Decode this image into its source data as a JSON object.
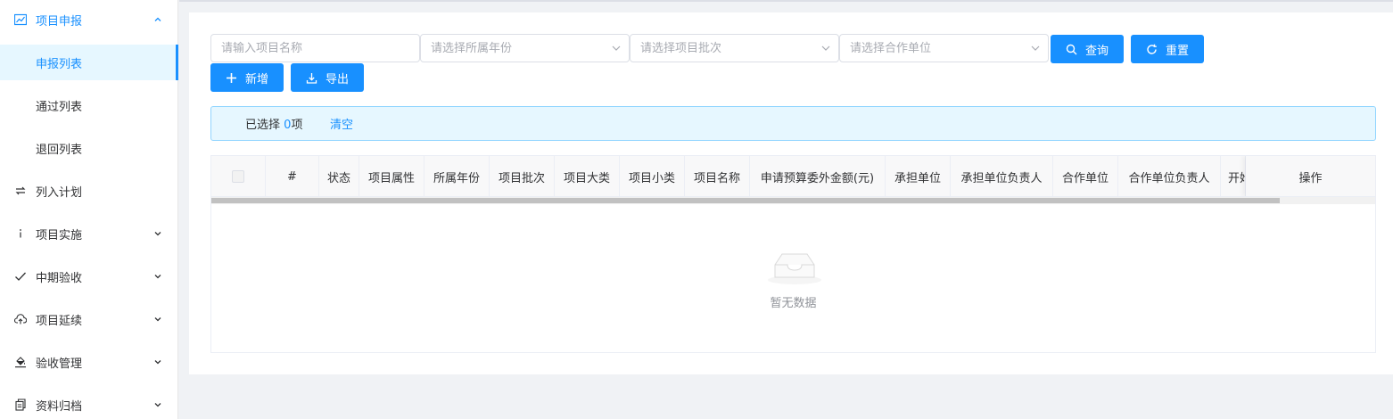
{
  "sidebar": {
    "items": [
      {
        "label": "项目申报",
        "icon": "line-chart-icon",
        "state": "parent-active",
        "arrow": "up"
      },
      {
        "label": "申报列表",
        "state": "sub-active"
      },
      {
        "label": "通过列表",
        "state": "sub"
      },
      {
        "label": "退回列表",
        "state": "sub"
      },
      {
        "label": "列入计划",
        "icon": "swap-icon"
      },
      {
        "label": "项目实施",
        "icon": "info-icon",
        "arrow": "down"
      },
      {
        "label": "中期验收",
        "icon": "check-icon",
        "arrow": "down"
      },
      {
        "label": "项目延续",
        "icon": "cloud-upload-icon",
        "arrow": "down"
      },
      {
        "label": "验收管理",
        "icon": "fill-bucket-icon",
        "arrow": "down"
      },
      {
        "label": "资料归档",
        "icon": "document-copy-icon",
        "arrow": "down"
      }
    ]
  },
  "search": {
    "project_name_placeholder": "请输入项目名称",
    "year_placeholder": "请选择所属年份",
    "batch_placeholder": "请选择项目批次",
    "partner_placeholder": "请选择合作单位",
    "query_label": "查询",
    "reset_label": "重置"
  },
  "toolbar": {
    "add_label": "新增",
    "export_label": "导出"
  },
  "alert": {
    "selected_prefix": "已选择",
    "selected_count": "0",
    "selected_suffix": "项",
    "clear_label": "清空"
  },
  "table": {
    "columns": [
      "#",
      "状态",
      "项目属性",
      "所属年份",
      "项目批次",
      "项目大类",
      "项目小类",
      "项目名称",
      "申请预算委外金额(元)",
      "承担单位",
      "承担单位负责人",
      "合作单位",
      "合作单位负责人",
      "开始时间"
    ],
    "operation_label": "操作",
    "empty_text": "暂无数据"
  },
  "colors": {
    "primary": "#1890ff",
    "alert_bg": "#e6f7ff",
    "alert_border": "#91d5ff"
  }
}
